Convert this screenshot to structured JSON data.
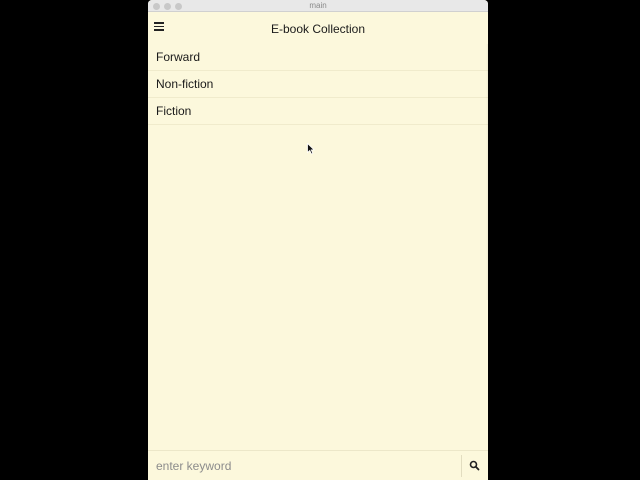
{
  "window": {
    "title": "main"
  },
  "header": {
    "title": "E-book Collection",
    "menu_icon": "hamburger-menu-icon"
  },
  "categories": [
    {
      "label": "Forward"
    },
    {
      "label": "Non-fiction"
    },
    {
      "label": "Fiction"
    }
  ],
  "search": {
    "placeholder": "enter keyword",
    "value": "",
    "icon": "search-icon"
  },
  "colors": {
    "background": "#fcf8dc",
    "text": "#1a1a1a"
  }
}
